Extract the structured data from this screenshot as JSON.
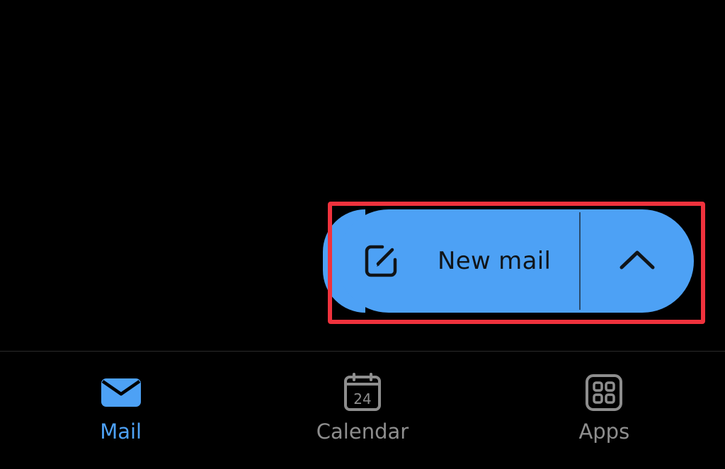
{
  "fab": {
    "label": "New mail",
    "compose_icon": "compose-icon",
    "expand_icon": "chevron-up-icon"
  },
  "bottom_nav": {
    "items": [
      {
        "label": "Mail",
        "icon": "mail-icon",
        "active": true
      },
      {
        "label": "Calendar",
        "icon": "calendar-icon",
        "active": false,
        "icon_text": "24"
      },
      {
        "label": "Apps",
        "icon": "apps-grid-icon",
        "active": false
      }
    ]
  },
  "colors": {
    "background": "#000000",
    "accent": "#4da1f5",
    "highlight": "#f0323d",
    "inactive": "#8e8e8e"
  }
}
